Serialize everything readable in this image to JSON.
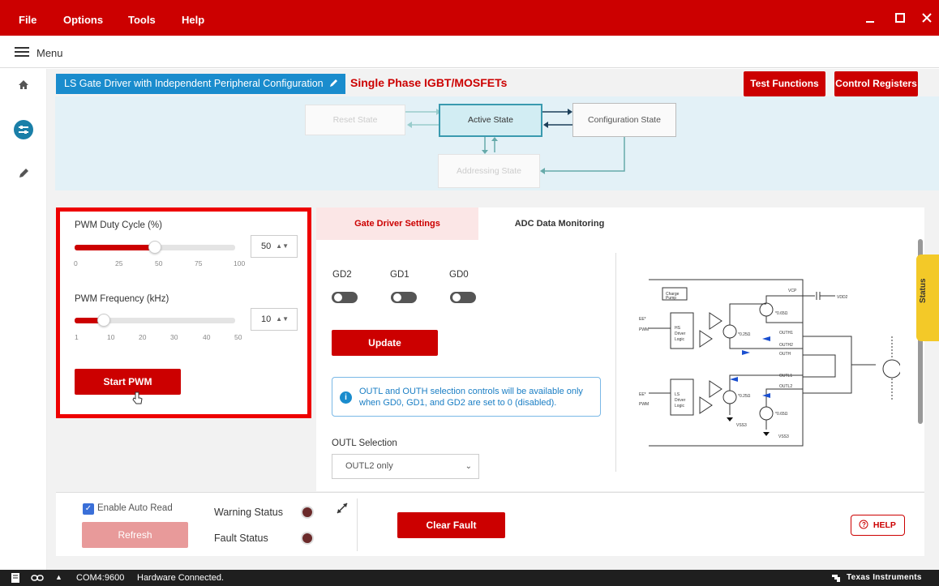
{
  "app": {
    "menu_items": [
      "File",
      "Options",
      "Tools",
      "Help"
    ],
    "window_controls": [
      "minimize-icon",
      "maximize-icon",
      "close-icon"
    ],
    "brand_color": "#cc0000"
  },
  "menubar": {
    "label": "Menu"
  },
  "sidebar": {
    "icons": [
      "home-icon",
      "sliders-icon",
      "pencil-icon"
    ]
  },
  "header": {
    "device_title": "LS Gate Driver with Independent Peripheral Configuration",
    "phase_label": "Single Phase IGBT/MOSFETs",
    "test_functions_label": "Test Functions",
    "control_registers_label": "Control Registers"
  },
  "states": {
    "reset": "Reset State",
    "active": "Active State",
    "configuration": "Configuration State",
    "addressing": "Addressing State"
  },
  "pwm": {
    "duty_label": "PWM Duty Cycle (%)",
    "duty_value": "50",
    "duty_ticks": [
      "0",
      "25",
      "50",
      "75",
      "100"
    ],
    "duty_fraction": 0.5,
    "freq_label": "PWM Frequency (kHz)",
    "freq_value": "10",
    "freq_ticks": [
      "1",
      "10",
      "20",
      "30",
      "40",
      "50"
    ],
    "freq_fraction": 0.18,
    "start_label": "Start PWM"
  },
  "tabs": {
    "gate_driver": "Gate Driver Settings",
    "adc": "ADC Data Monitoring"
  },
  "gate_driver": {
    "gd2": "GD2",
    "gd1": "GD1",
    "gd0": "GD0",
    "update_label": "Update",
    "info_text": "OUTL and OUTH selection controls will be available only when GD0, GD1, and GD2 are set to 0 (disabled).",
    "outl_label": "OUTL Selection",
    "outl_value": "OUTL2 only"
  },
  "status_tab": "Status",
  "bottom": {
    "auto_read_label": "Enable Auto Read",
    "refresh_label": "Refresh",
    "warning_label": "Warning Status",
    "fault_label": "Fault Status",
    "clear_fault_label": "Clear Fault",
    "help_label": "HELP"
  },
  "statusbar": {
    "port": "COM4:9600",
    "status": "Hardware Connected.",
    "brand": "Texas Instruments"
  }
}
